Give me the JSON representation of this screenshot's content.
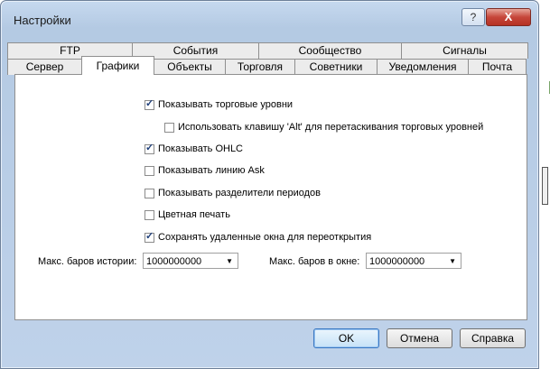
{
  "window": {
    "title": "Настройки",
    "help_label": "?",
    "close_label": "X"
  },
  "tabs_row1": [
    {
      "label": "FTP"
    },
    {
      "label": "События"
    },
    {
      "label": "Сообщество"
    },
    {
      "label": "Сигналы"
    }
  ],
  "tabs_row2": [
    {
      "label": "Сервер"
    },
    {
      "label": "Графики",
      "active": true
    },
    {
      "label": "Объекты"
    },
    {
      "label": "Торговля"
    },
    {
      "label": "Советники"
    },
    {
      "label": "Уведомления"
    },
    {
      "label": "Почта"
    }
  ],
  "options": [
    {
      "label": "Показывать торговые уровни",
      "checked": true
    },
    {
      "label": "Использовать клавишу 'Alt' для перетаскивания торговых уровней",
      "checked": false
    },
    {
      "label": "Показывать OHLC",
      "checked": true
    },
    {
      "label": "Показывать линию Ask",
      "checked": false
    },
    {
      "label": "Показывать разделители периодов",
      "checked": false
    },
    {
      "label": "Цветная печать",
      "checked": false
    },
    {
      "label": "Сохранять удаленные окна для переоткрытия",
      "checked": true
    }
  ],
  "max_bars_history": {
    "label": "Макс. баров истории:",
    "value": "1000000000"
  },
  "max_bars_window": {
    "label": "Макс. баров в окне:",
    "value": "1000000000"
  },
  "buttons": {
    "ok": "OK",
    "cancel": "Отмена",
    "help": "Справка"
  }
}
